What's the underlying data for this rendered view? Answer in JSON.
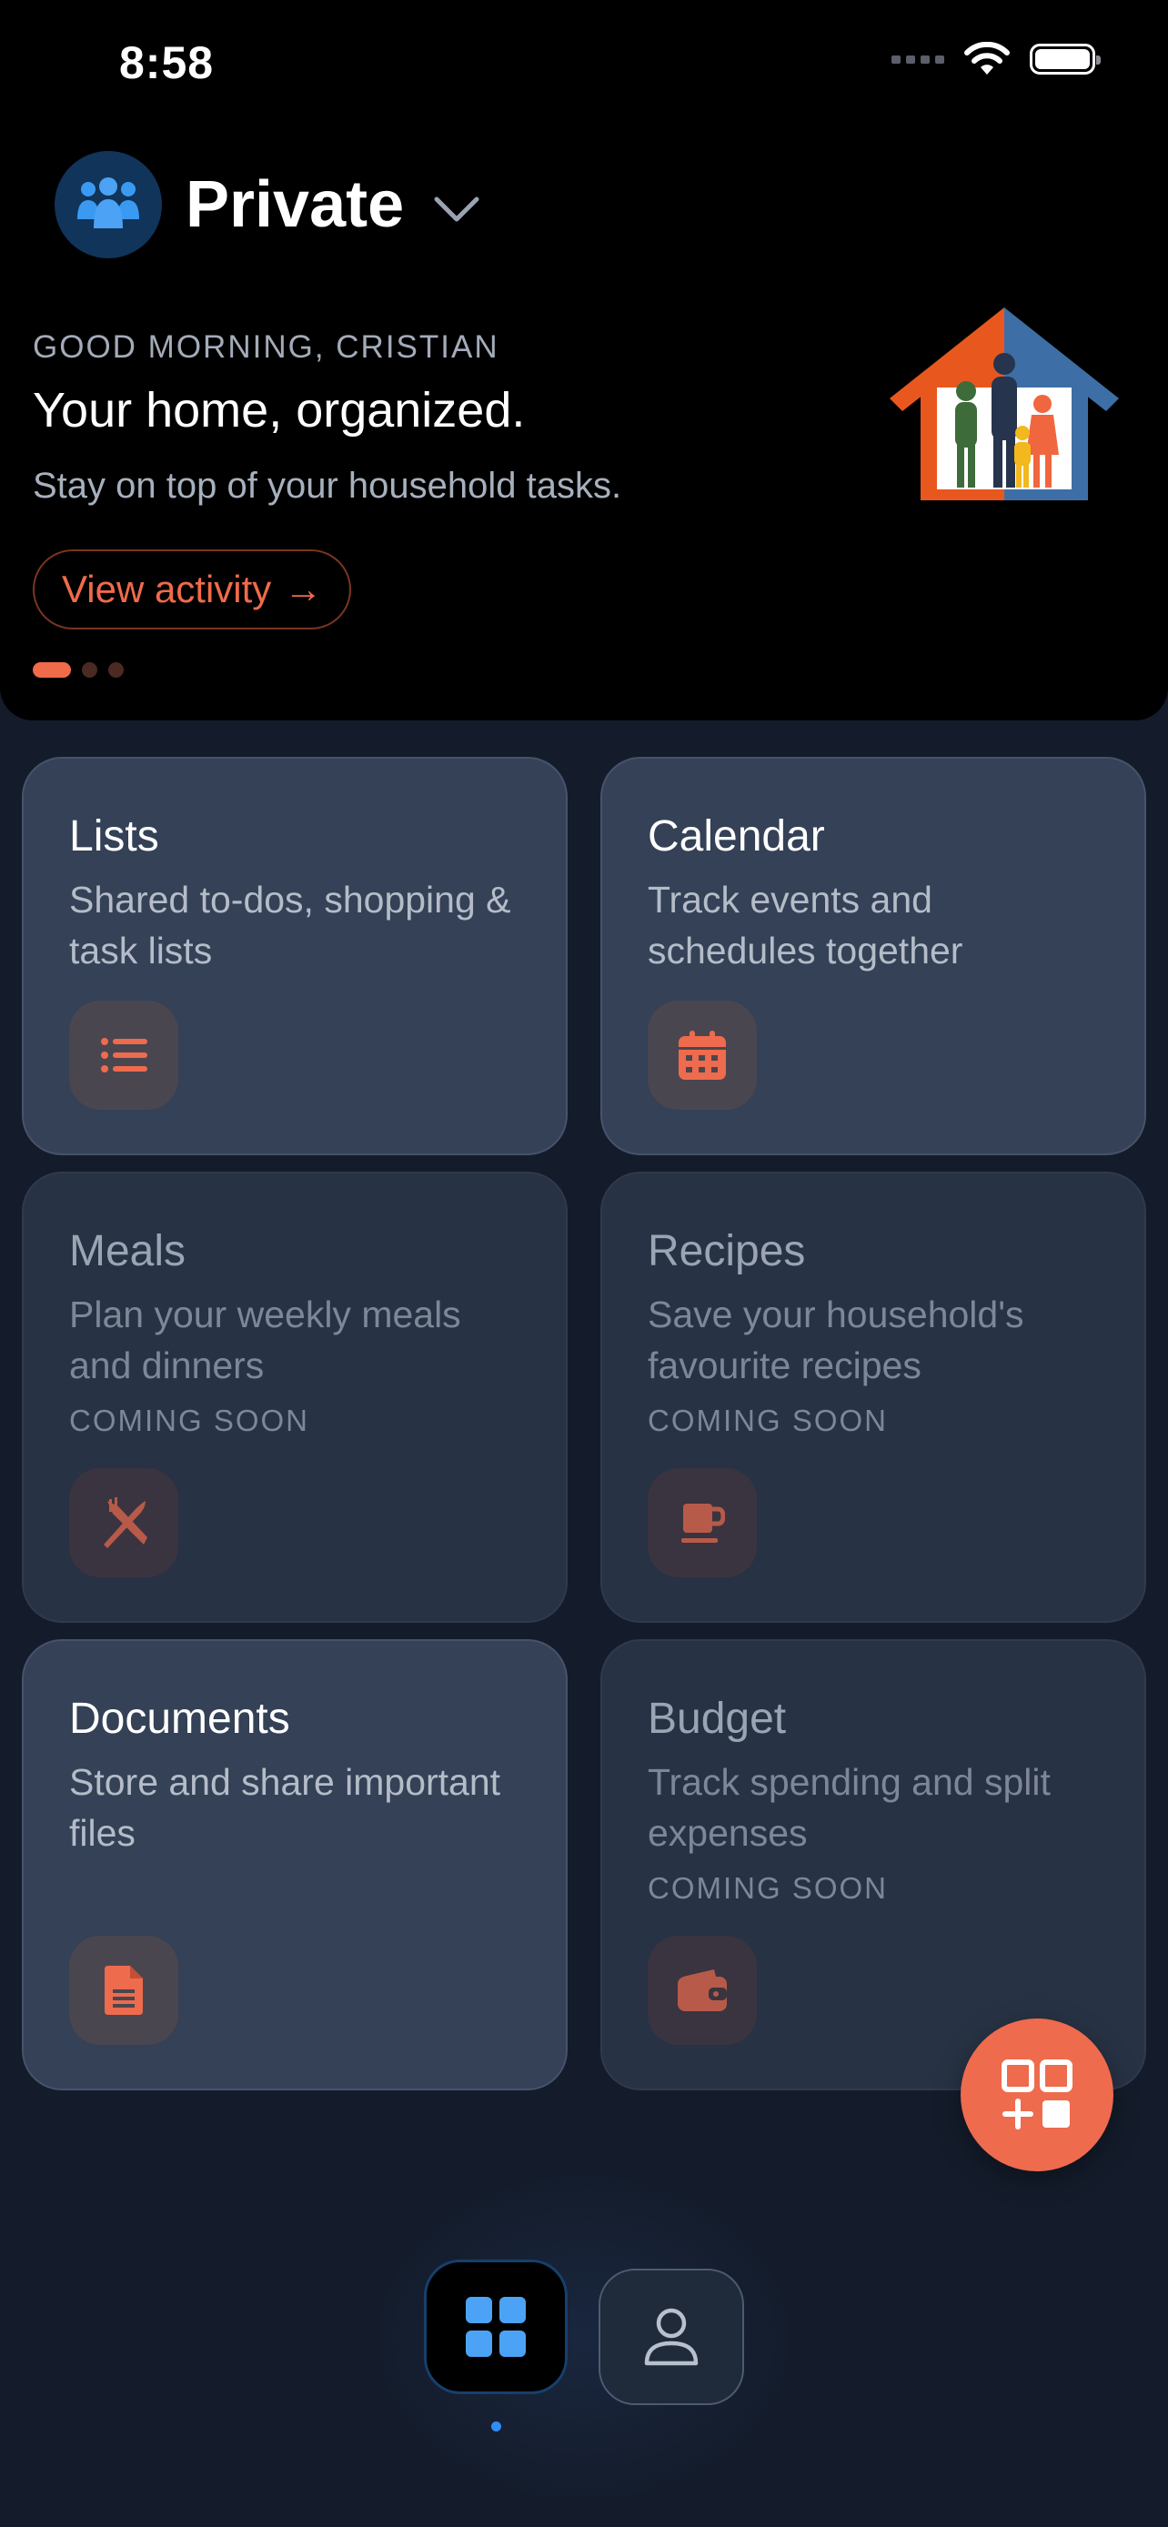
{
  "status_bar": {
    "time": "8:58"
  },
  "household": {
    "name": "Private"
  },
  "hero": {
    "greeting": "GOOD MORNING, CRISTIAN",
    "title": "Your home, organized.",
    "subtitle": "Stay on top of your household tasks.",
    "cta_label": "View activity",
    "cta_arrow": "→",
    "carousel_pages": 3,
    "carousel_active": 1
  },
  "cards": [
    {
      "title": "Lists",
      "description": "Shared to-dos, shopping & task lists",
      "badge": "",
      "icon": "list-icon"
    },
    {
      "title": "Calendar",
      "description": "Track events and schedules together",
      "badge": "",
      "icon": "calendar-icon"
    },
    {
      "title": "Meals",
      "description": "Plan your weekly meals and dinners",
      "badge": "COMING SOON",
      "icon": "utensils-icon"
    },
    {
      "title": "Recipes",
      "description": "Save your household's favourite recipes",
      "badge": "COMING SOON",
      "icon": "mug-icon"
    },
    {
      "title": "Documents",
      "description": "Store and share important files",
      "badge": "",
      "icon": "document-icon"
    },
    {
      "title": "Budget",
      "description": "Track spending and split expenses",
      "badge": "COMING SOON",
      "icon": "wallet-icon"
    }
  ],
  "colors": {
    "accent": "#ee6b4d",
    "tab_active": "#4ca3f5",
    "background": "#141c2b"
  },
  "tabs": [
    {
      "name": "home",
      "icon": "grid-icon",
      "active": true
    },
    {
      "name": "profile",
      "icon": "person-icon",
      "active": false
    }
  ]
}
